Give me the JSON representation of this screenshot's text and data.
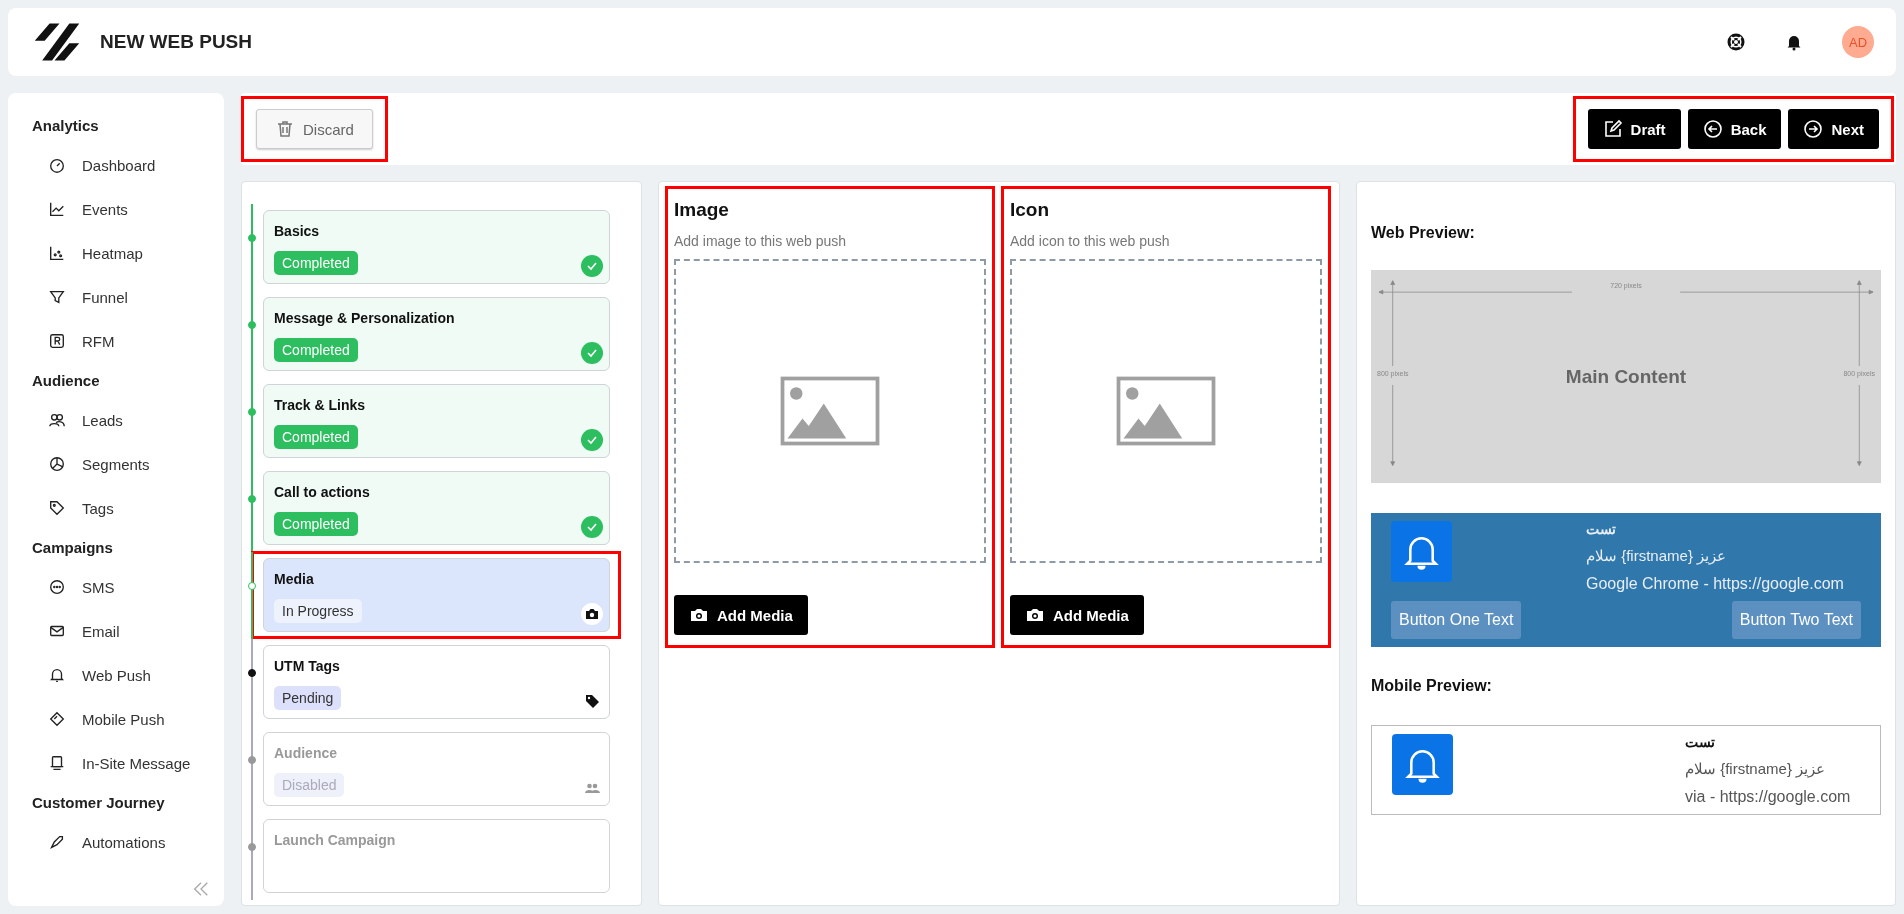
{
  "header": {
    "title": "NEW WEB PUSH",
    "avatar": "AD"
  },
  "sidebar": {
    "sections": [
      {
        "title": "Analytics",
        "items": [
          {
            "label": "Dashboard"
          },
          {
            "label": "Events"
          },
          {
            "label": "Heatmap"
          },
          {
            "label": "Funnel"
          },
          {
            "label": "RFM"
          }
        ]
      },
      {
        "title": "Audience",
        "items": [
          {
            "label": "Leads"
          },
          {
            "label": "Segments"
          },
          {
            "label": "Tags"
          }
        ]
      },
      {
        "title": "Campaigns",
        "items": [
          {
            "label": "SMS"
          },
          {
            "label": "Email"
          },
          {
            "label": "Web Push"
          },
          {
            "label": "Mobile Push"
          },
          {
            "label": "In-Site Message"
          }
        ]
      },
      {
        "title": "Customer Journey",
        "items": [
          {
            "label": "Automations"
          }
        ]
      }
    ]
  },
  "toolbar": {
    "discard": {
      "label": "Discard",
      "highlighted": true
    },
    "actions": {
      "highlighted": true,
      "buttons": [
        {
          "label": "Draft"
        },
        {
          "label": "Back"
        },
        {
          "label": "Next"
        }
      ]
    }
  },
  "steps": [
    {
      "title": "Basics",
      "status": "Completed",
      "kind": "completed",
      "highlighted": false
    },
    {
      "title": "Message & Personalization",
      "status": "Completed",
      "kind": "completed",
      "highlighted": false
    },
    {
      "title": "Track & Links",
      "status": "Completed",
      "kind": "completed",
      "highlighted": false
    },
    {
      "title": "Call to actions",
      "status": "Completed",
      "kind": "completed",
      "highlighted": false
    },
    {
      "title": "Media",
      "status": "In Progress",
      "kind": "in_progress",
      "highlighted": true
    },
    {
      "title": "UTM Tags",
      "status": "Pending",
      "kind": "pending",
      "highlighted": false
    },
    {
      "title": "Audience",
      "status": "Disabled",
      "kind": "disabled",
      "highlighted": false
    },
    {
      "title": "Launch Campaign",
      "kind": "disabled",
      "highlighted": false
    }
  ],
  "media": [
    {
      "title": "Image",
      "hint": "Add image to this web push",
      "button": "Add Media",
      "highlighted": true
    },
    {
      "title": "Icon",
      "hint": "Add icon to this web push",
      "button": "Add Media",
      "highlighted": true
    }
  ],
  "preview": {
    "web_label": "Web Preview:",
    "diagram": {
      "width_label": "720 pixels",
      "left_label": "800 pixels",
      "right_label": "800 pixels",
      "center": "Main Content"
    },
    "web_notification": {
      "title": "تست",
      "body": "عزیز {firstname} سلام",
      "source": "Google Chrome - https://google.com",
      "buttons": [
        "Button One Text",
        "Button Two Text"
      ]
    },
    "mobile_label": "Mobile Preview:",
    "mobile_notification": {
      "title": "تست",
      "body": "عزیز {firstname} سلام",
      "source": "via - https://google.com"
    }
  }
}
